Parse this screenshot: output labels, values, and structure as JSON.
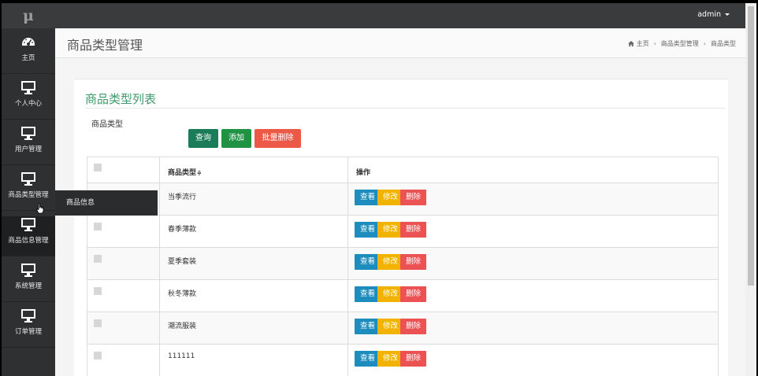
{
  "app": {
    "logo": "μ"
  },
  "topbar": {
    "user": "admin"
  },
  "sidebar": {
    "items": [
      {
        "label": "主页",
        "icon": "dashboard-icon"
      },
      {
        "label": "个人中心",
        "icon": "monitor-icon"
      },
      {
        "label": "用户管理",
        "icon": "monitor-icon"
      },
      {
        "label": "商品类型管理",
        "icon": "monitor-icon"
      },
      {
        "label": "商品信息管理",
        "icon": "monitor-icon"
      },
      {
        "label": "系统管理",
        "icon": "monitor-icon"
      },
      {
        "label": "订单管理",
        "icon": "monitor-icon"
      }
    ],
    "flyout": {
      "label": "商品信息"
    }
  },
  "header": {
    "title": "商品类型管理",
    "breadcrumb": [
      "主页",
      "商品类型管理",
      "商品类型"
    ]
  },
  "card": {
    "title": "商品类型列表",
    "filter_label": "商品类型",
    "filter_value": "",
    "buttons": {
      "query": "查询",
      "add": "添加",
      "batch_delete": "批量删除"
    }
  },
  "table": {
    "columns": [
      "",
      "商品类型",
      "操作"
    ],
    "sort_indicator": "≑",
    "rows": [
      {
        "name": "当季流行"
      },
      {
        "name": "春季薄款"
      },
      {
        "name": "夏季套装"
      },
      {
        "name": "秋冬薄款"
      },
      {
        "name": "潮流服装"
      },
      {
        "name": "111111"
      }
    ],
    "actions": {
      "view": "查看",
      "edit": "修改",
      "delete": "删除"
    }
  },
  "colors": {
    "accent_green": "#3e9b6b",
    "query": "#1a7c58",
    "add": "#1f9244",
    "batch_delete": "#ec5a47",
    "view": "#1d8dbe",
    "edit": "#f1b300",
    "delete": "#ec5254"
  }
}
